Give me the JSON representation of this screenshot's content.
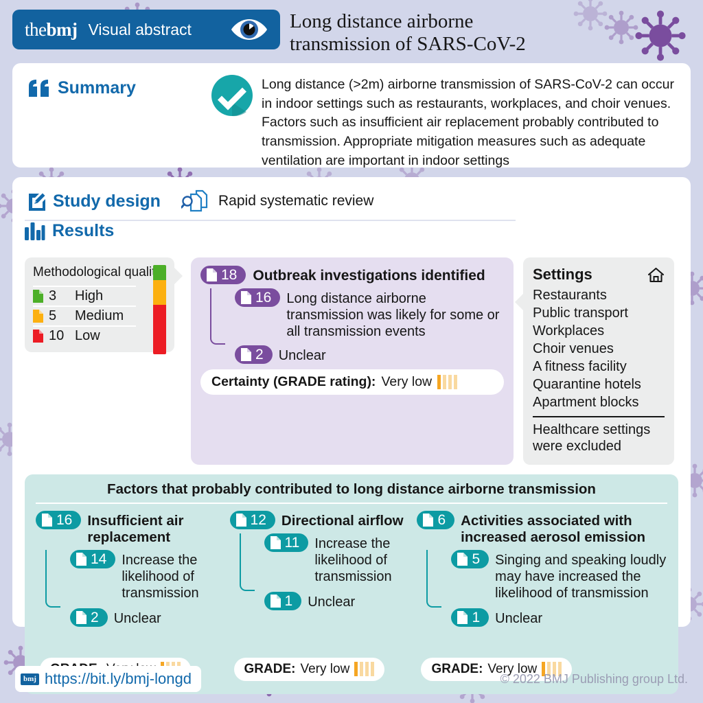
{
  "header": {
    "brand_the": "the",
    "brand_bmj": "bmj",
    "subtitle": "Visual abstract",
    "eye_icon": "eye-icon",
    "title": "Long distance airborne\ntransmission of SARS-CoV-2"
  },
  "summary": {
    "label": "Summary",
    "quote_icon": "quote-icon",
    "check_icon": "check-circle-icon",
    "text": "Long distance (>2m) airborne transmission of SARS-CoV-2 can occur in indoor settings such as restaurants, workplaces, and choir venues. Factors such as insufficient air replacement probably contributed to transmission. Appropriate mitigation measures such as adequate ventilation are important in indoor settings"
  },
  "study_design": {
    "label": "Study design",
    "pencil_icon": "pencil-icon",
    "review_icon": "document-search-icon",
    "value": "Rapid systematic review"
  },
  "results": {
    "label": "Results",
    "bar_icon": "bar-chart-icon",
    "methodological_quality": {
      "title": "Methodological\nquality",
      "rows": [
        {
          "count": "3",
          "label": "High",
          "color": "#4caf28"
        },
        {
          "count": "5",
          "label": "Medium",
          "color": "#fcb010"
        },
        {
          "count": "10",
          "label": "Low",
          "color": "#ec1c24"
        }
      ],
      "bar_segments": [
        {
          "label": "High",
          "color": "#4caf28",
          "share": 16.7
        },
        {
          "label": "Medium",
          "color": "#fcb010",
          "share": 27.8
        },
        {
          "label": "Low",
          "color": "#ec1c24",
          "share": 55.5
        }
      ]
    },
    "outbreak": {
      "count": "18",
      "title": "Outbreak investigations identified",
      "children": [
        {
          "count": "16",
          "text": "Long distance airborne transmission was likely for some or all transmission events"
        },
        {
          "count": "2",
          "text": "Unclear"
        }
      ],
      "certainty_label": "Certainty (GRADE rating):",
      "certainty_value": "Very low",
      "grade_filled": 1,
      "grade_total": 4
    }
  },
  "settings": {
    "title": "Settings",
    "home_icon": "home-icon",
    "items": [
      "Restaurants",
      "Public transport",
      "Workplaces",
      "Choir venues",
      "A fitness facility",
      "Quarantine hotels",
      "Apartment blocks"
    ],
    "note": "Healthcare settings were excluded"
  },
  "factors": {
    "title": "Factors that probably contributed to long distance airborne transmission",
    "grade_label": "GRADE:",
    "grade_value": "Very low",
    "grade_filled": 1,
    "grade_total": 4,
    "columns": [
      {
        "count": "16",
        "name": "Insufficient air replacement",
        "children": [
          {
            "count": "14",
            "text": "Increase the likelihood of transmission"
          },
          {
            "count": "2",
            "text": "Unclear"
          }
        ]
      },
      {
        "count": "12",
        "name": "Directional airflow",
        "children": [
          {
            "count": "11",
            "text": "Increase the likelihood of transmission"
          },
          {
            "count": "1",
            "text": "Unclear"
          }
        ]
      },
      {
        "count": "6",
        "name": "Activities associated with increased aerosol emission",
        "children": [
          {
            "count": "5",
            "text": "Singing and speaking loudly may have increased the likelihood of transmission"
          },
          {
            "count": "1",
            "text": "Unclear"
          }
        ]
      }
    ]
  },
  "footer": {
    "logo_icon": "bmj-logo-icon",
    "url": "https://bit.ly/bmj-longd",
    "copyright": "© 2022 BMJ Publishing group Ltd."
  },
  "colors": {
    "bmj_blue": "#12629f",
    "teal": "#0d9ba3",
    "purple": "#7a4d9e",
    "panel_lavender": "#e5def0",
    "panel_teal": "#cde8e6",
    "page_bg": "#d2d6ea",
    "grade_on": "#f5a623",
    "grade_off": "#f9d9a0"
  }
}
